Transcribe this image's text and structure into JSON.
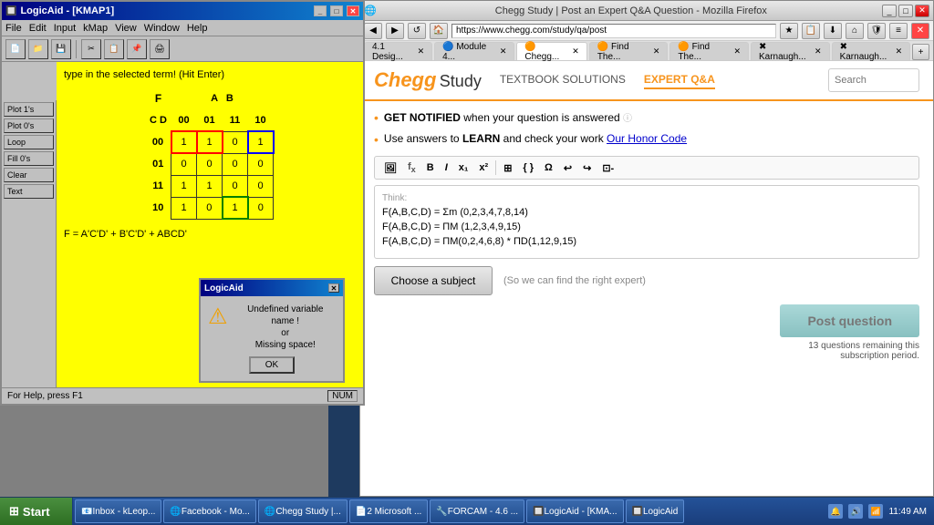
{
  "browser": {
    "title": "Chegg...",
    "tabs": [
      {
        "label": "4.1 Desig...",
        "active": false
      },
      {
        "label": "Module 4...",
        "active": false
      },
      {
        "label": "Chegg...",
        "active": true
      },
      {
        "label": "Find The...",
        "active": false
      },
      {
        "label": "Find The...",
        "active": false
      },
      {
        "label": "Karnaugh...",
        "active": false
      },
      {
        "label": "Karnaugh...",
        "active": false
      }
    ],
    "address": "https://www.chegg.com/study/qa/post",
    "search_placeholder": "Search"
  },
  "chegg": {
    "logo": "Chegg",
    "logo_suffix": " Study",
    "nav": {
      "textbook": "TEXTBOOK SOLUTIONS",
      "expert": "EXPERT Q&A"
    },
    "search_placeholder": "Search",
    "notice1_bold": "GET NOTIFIED",
    "notice1_text": " when your question is answered",
    "notice2_pre": "Use answers to ",
    "notice2_bold": "LEARN",
    "notice2_mid": " and check your work ",
    "notice2_link": "Our Honor Code",
    "think_label": "Think:",
    "equations": [
      "F(A,B,C,D) = Σm (0,2,3,4,7,8,14)",
      "F(A,B,C,D) = ΠM (1,2,3,4,9,15)",
      "F(A,B,C,D) = ΠM(0,2,4,6,8) * ΠD(1,12,9,15)"
    ],
    "subject_btn": "Choose a subject",
    "subject_hint": "(So we can find the right expert)",
    "post_btn": "Post question",
    "questions_remaining": "13 questions remaining this",
    "questions_remaining2": "subscription period."
  },
  "kmap": {
    "title": "LogicAid - [KMAP1]",
    "instruction": "type in the selected term! (Hit Enter)",
    "menu": [
      "File",
      "Edit",
      "Input",
      "kMap",
      "View",
      "Window",
      "Help"
    ],
    "left_buttons": [
      "Plot 1's",
      "Plot 0's",
      "Loop",
      "Fill 0's",
      "Clear",
      "Text"
    ],
    "headers": {
      "f_label": "F",
      "ab_label": "A B",
      "cd_label": "C D",
      "col_headers": [
        "00",
        "01",
        "11",
        "10"
      ],
      "row_headers": [
        "00",
        "01",
        "11",
        "10"
      ]
    },
    "table_data": [
      [
        "1",
        "1",
        "0",
        "1"
      ],
      [
        "0",
        "0",
        "0",
        "0"
      ],
      [
        "1",
        "1",
        "0",
        "0"
      ],
      [
        "1",
        "0",
        "1",
        "0"
      ]
    ],
    "circled_cells": [
      [
        0,
        0
      ],
      [
        0,
        1
      ],
      [
        0,
        3
      ],
      [
        2,
        0
      ],
      [
        2,
        1
      ],
      [
        3,
        0
      ],
      [
        3,
        2
      ]
    ],
    "equation": "F = A'C'D' + B'C'D' + ABCD'",
    "status": "For Help, press F1",
    "status_right": "NUM"
  },
  "dialog": {
    "title": "LogicAid",
    "message_line1": "Undefined variable name !",
    "message_line2": "or",
    "message_line3": "Missing space!",
    "ok_btn": "OK"
  },
  "taskbar": {
    "start": "Start",
    "items": [
      {
        "label": "Inbox - kLeop...",
        "icon": "📧"
      },
      {
        "label": "Facebook - Mo...",
        "icon": "🌐"
      },
      {
        "label": "Chegg Study |...",
        "icon": "🌐"
      },
      {
        "label": "2 Microsoft ...",
        "icon": "📄"
      },
      {
        "label": "FORCAM - 4.6 ...",
        "icon": "🔧"
      },
      {
        "label": "LogicAid - [KMA...",
        "icon": "🔲"
      },
      {
        "label": "LogicAid",
        "icon": "🔲"
      }
    ],
    "time": "11:49 AM"
  }
}
